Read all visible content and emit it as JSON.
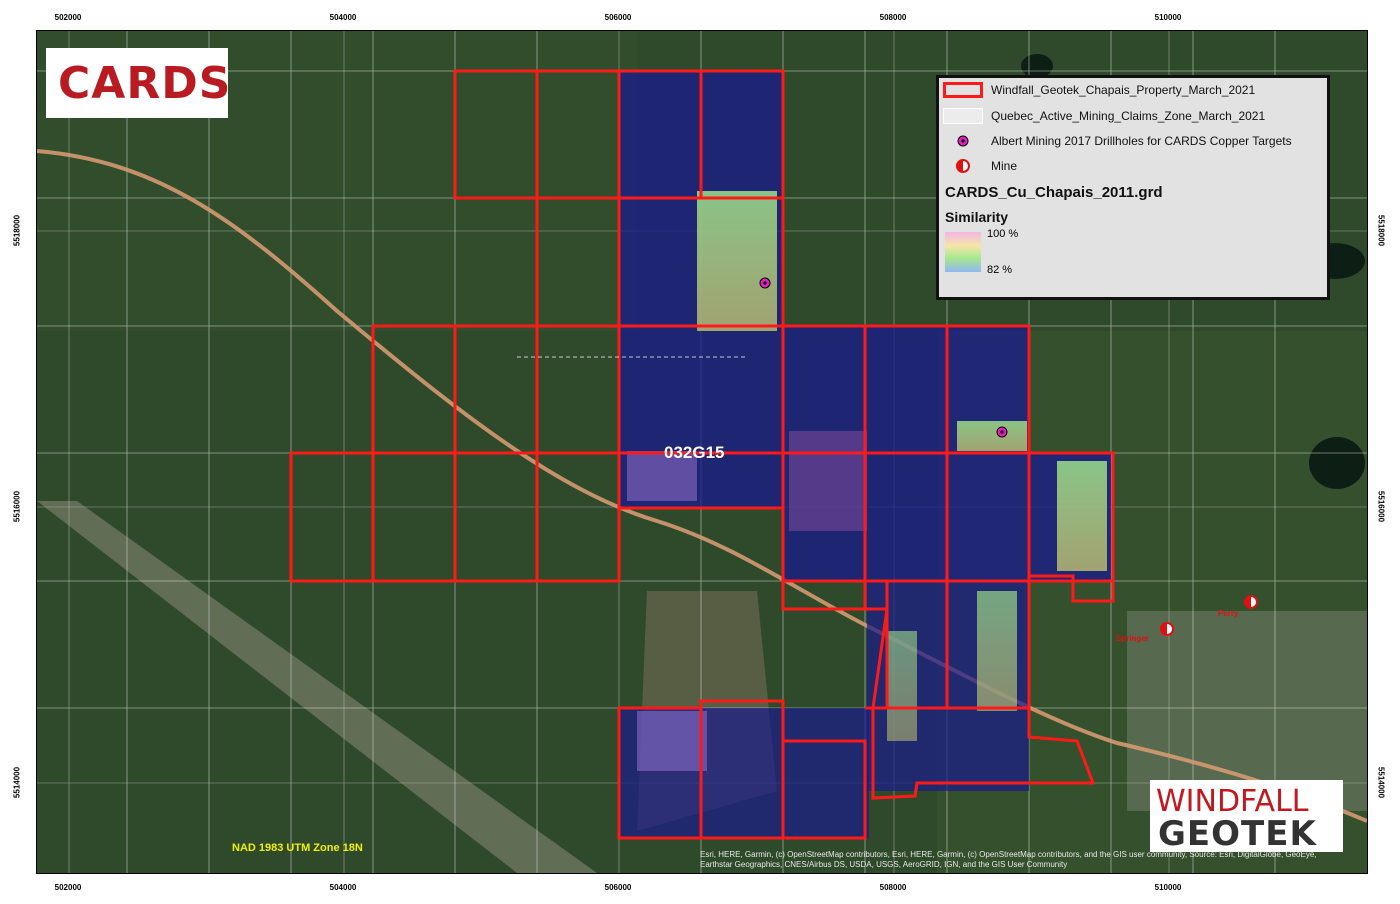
{
  "axes": {
    "x_ticks": [
      "502000",
      "504000",
      "506000",
      "508000",
      "510000"
    ],
    "y_ticks": [
      "5518000",
      "5516000",
      "5514000"
    ]
  },
  "logos": {
    "cards": "CARDS",
    "windfall_line1": "WINDFALL",
    "windfall_line2": "GEOTEK"
  },
  "legend": {
    "items": [
      {
        "label": "Windfall_Geotek_Chapais_Property_March_2021",
        "icon": "property-outline-swatch"
      },
      {
        "label": "Quebec_Active_Mining_Claims_Zone_March_2021",
        "icon": "claims-zone-swatch"
      },
      {
        "label": "Albert Mining 2017 Drillholes for CARDS Copper Targets",
        "icon": "drillhole-icon"
      },
      {
        "label": "Mine",
        "icon": "mine-icon"
      }
    ],
    "grid_title": "CARDS_Cu_Chapais_2011.grd",
    "similarity_title": "Similarity",
    "high": "100 %",
    "low": "82 %"
  },
  "map": {
    "sheet_label": "032G15",
    "datum": "NAD 1983 UTM Zone 18N",
    "credits": "Esri, HERE, Garmin, (c) OpenStreetMap contributors, Esri, HERE, Garmin, (c) OpenStreetMap contributors, and the GIS user community, Source: Esri, DigitalGlobe, GeoEye, Earthstar Geographics, CNES/Airbus DS, USDA, USGS, AeroGRID, IGN, and the GIS User Community",
    "towns": [
      "Springer",
      "Perry"
    ]
  },
  "colors": {
    "property_outline": "#ff1a1a",
    "forest": "#2f4a2a",
    "similarity_low": "#1a1a8c",
    "similarity_high": "#f5b6e4",
    "mine": "#e01010",
    "drillhole": "#e020c0"
  }
}
